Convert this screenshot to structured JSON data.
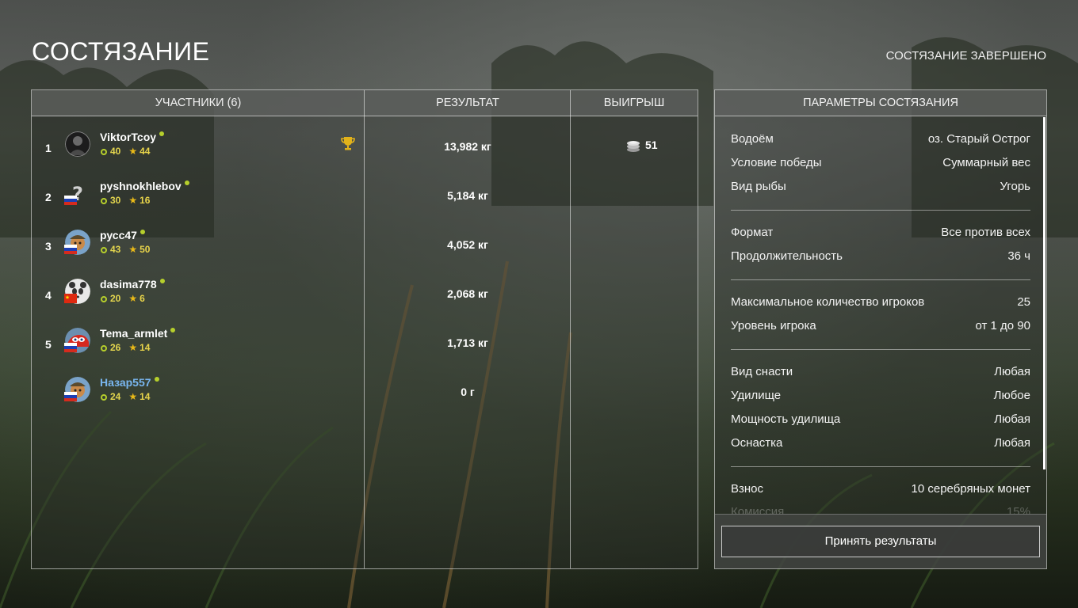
{
  "header": {
    "title": "СОСТЯЗАНИЕ",
    "status": "СОСТЯЗАНИЕ ЗАВЕРШЕНО"
  },
  "table": {
    "columns": {
      "participants": "УЧАСТНИКИ (6)",
      "result": "РЕЗУЛЬТАТ",
      "prize": "ВЫИГРЫШ"
    },
    "rows": [
      {
        "rank": "1",
        "name": "ViktorTcoy",
        "level": "40",
        "stars": "44",
        "result": "13,982 кг",
        "prize": "51",
        "flag": "none",
        "avatar": "dark-portrait",
        "trophy": true,
        "self": false
      },
      {
        "rank": "2",
        "name": "pyshnokhlebov",
        "level": "30",
        "stars": "16",
        "result": "5,184 кг",
        "prize": "",
        "flag": "russia",
        "avatar": "question-mark",
        "trophy": false,
        "self": false
      },
      {
        "rank": "3",
        "name": "русс47",
        "level": "43",
        "stars": "50",
        "result": "4,052 кг",
        "prize": "",
        "flag": "russia",
        "avatar": "cartoon-fisher",
        "trophy": false,
        "self": false
      },
      {
        "rank": "4",
        "name": "dasima778",
        "level": "20",
        "stars": "6",
        "result": "2,068 кг",
        "prize": "",
        "flag": "china",
        "avatar": "panda",
        "trophy": false,
        "self": false
      },
      {
        "rank": "5",
        "name": "Tema_armlet",
        "level": "26",
        "stars": "14",
        "result": "1,713 кг",
        "prize": "",
        "flag": "russia",
        "avatar": "red-car",
        "trophy": false,
        "self": false
      },
      {
        "rank": "",
        "name": "Назар557",
        "level": "24",
        "stars": "14",
        "result": "0 г",
        "prize": "",
        "flag": "russia",
        "avatar": "cartoon-fisher",
        "trophy": false,
        "self": true
      }
    ]
  },
  "params": {
    "title": "ПАРАМЕТРЫ СОСТЯЗАНИЯ",
    "groups": [
      [
        {
          "k": "Водоём",
          "v": "оз. Старый Острог"
        },
        {
          "k": "Условие победы",
          "v": "Суммарный вес"
        },
        {
          "k": "Вид рыбы",
          "v": "Угорь"
        }
      ],
      [
        {
          "k": "Формат",
          "v": "Все против всех"
        },
        {
          "k": "Продолжительность",
          "v": "36 ч"
        }
      ],
      [
        {
          "k": "Максимальное количество игроков",
          "v": "25"
        },
        {
          "k": "Уровень игрока",
          "v": "от 1 до 90"
        }
      ],
      [
        {
          "k": "Вид снасти",
          "v": "Любая"
        },
        {
          "k": "Удилище",
          "v": "Любое"
        },
        {
          "k": "Мощность удилища",
          "v": "Любая"
        },
        {
          "k": "Оснастка",
          "v": "Любая"
        }
      ],
      [
        {
          "k": "Взнос",
          "v": "10 серебряных монет"
        },
        {
          "k": "Комиссия",
          "v": "15%"
        }
      ]
    ],
    "accept_label": "Принять результаты"
  },
  "colors": {
    "online": "#b6cf2c",
    "level": "#e3d54e",
    "star": "#e9b918",
    "self_name": "#79b6ef",
    "trophy": "#e2b21a"
  }
}
